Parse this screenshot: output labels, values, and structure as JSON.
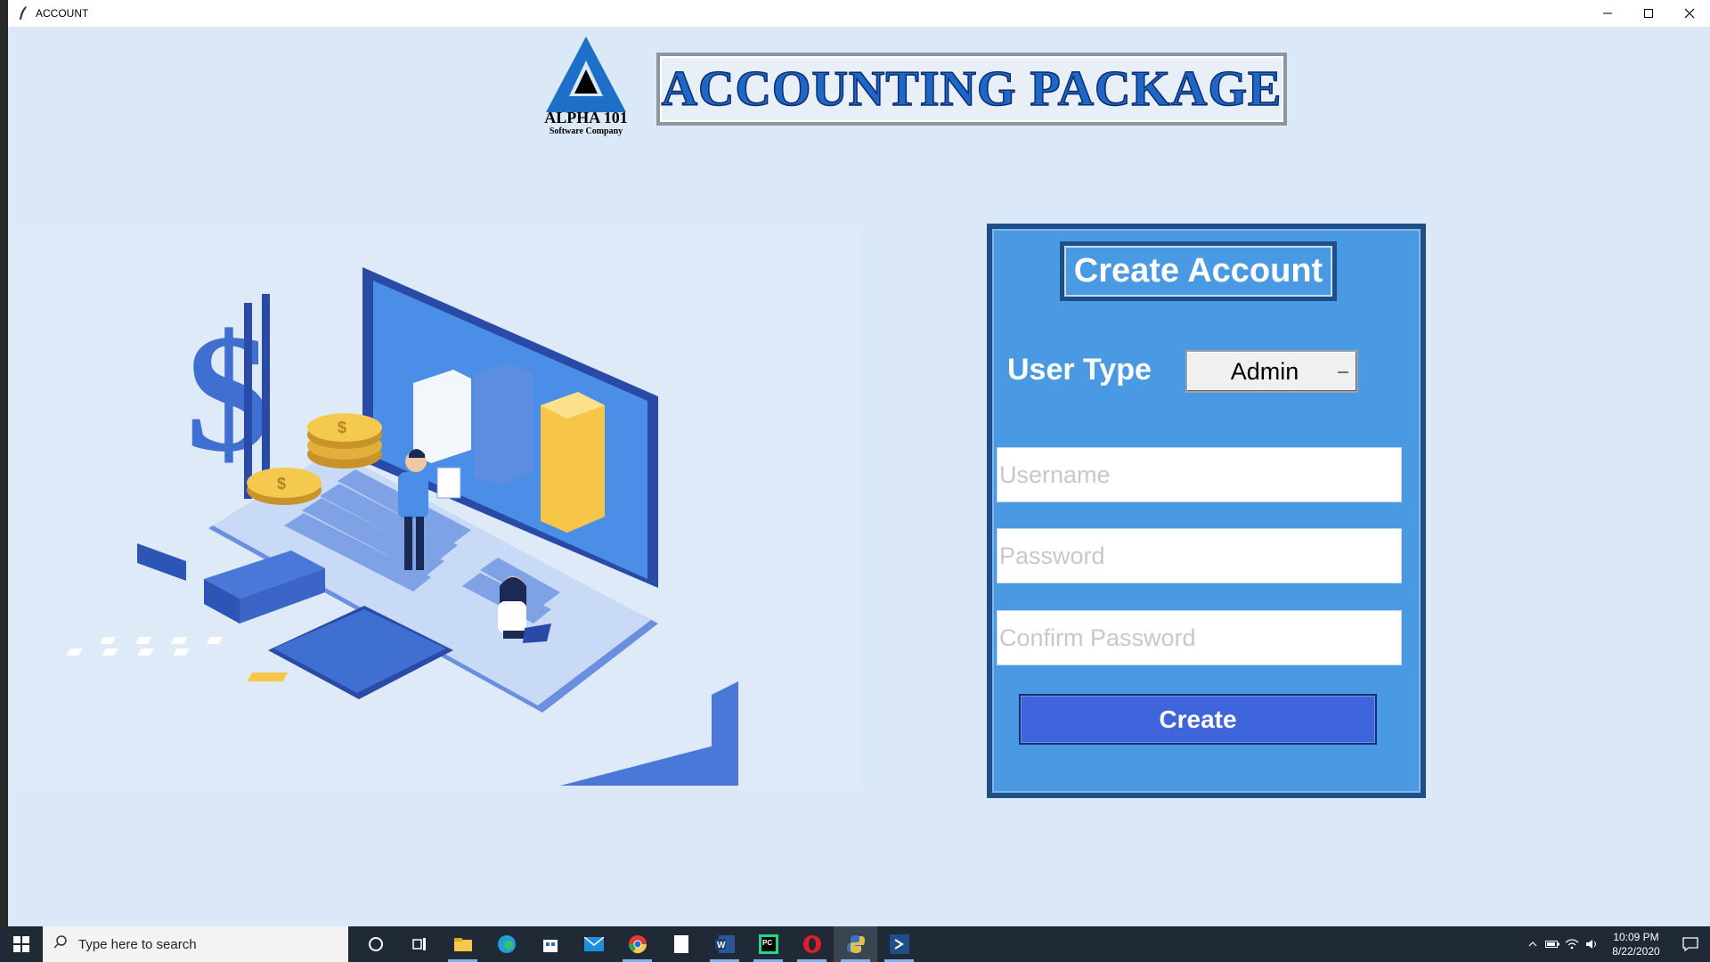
{
  "window": {
    "title": "ACCOUNT",
    "minimize_glyph": "—",
    "maximize_glyph": "☐",
    "close_glyph": "✕"
  },
  "logo": {
    "line1": "ALPHA 101",
    "line2": "Software Company"
  },
  "banner": {
    "title": "ACCOUNTING PACKAGE"
  },
  "form": {
    "heading": "Create Account",
    "user_type_label": "User Type",
    "user_type_value": "Admin",
    "username_placeholder": "Username",
    "password_placeholder": "Password",
    "confirm_password_placeholder": "Confirm Password",
    "create_label": "Create"
  },
  "taskbar": {
    "search_placeholder": "Type here to search",
    "apps": [
      "cortana-icon",
      "task-view-icon",
      "file-explorer-icon",
      "edge-icon",
      "store-icon",
      "mail-icon",
      "chrome-icon",
      "notepad-icon",
      "word-icon",
      "pycharm-icon",
      "opera-icon",
      "python-icon",
      "vscode-icon"
    ],
    "time": "10:09 PM",
    "date": "8/22/2020"
  },
  "colors": {
    "background": "#dbe8f7",
    "panel": "#4a9ae3",
    "panel_border": "#1e4f86",
    "button": "#3f65dd",
    "banner_text": "#1e66c8",
    "taskbar": "#1f2a36"
  }
}
